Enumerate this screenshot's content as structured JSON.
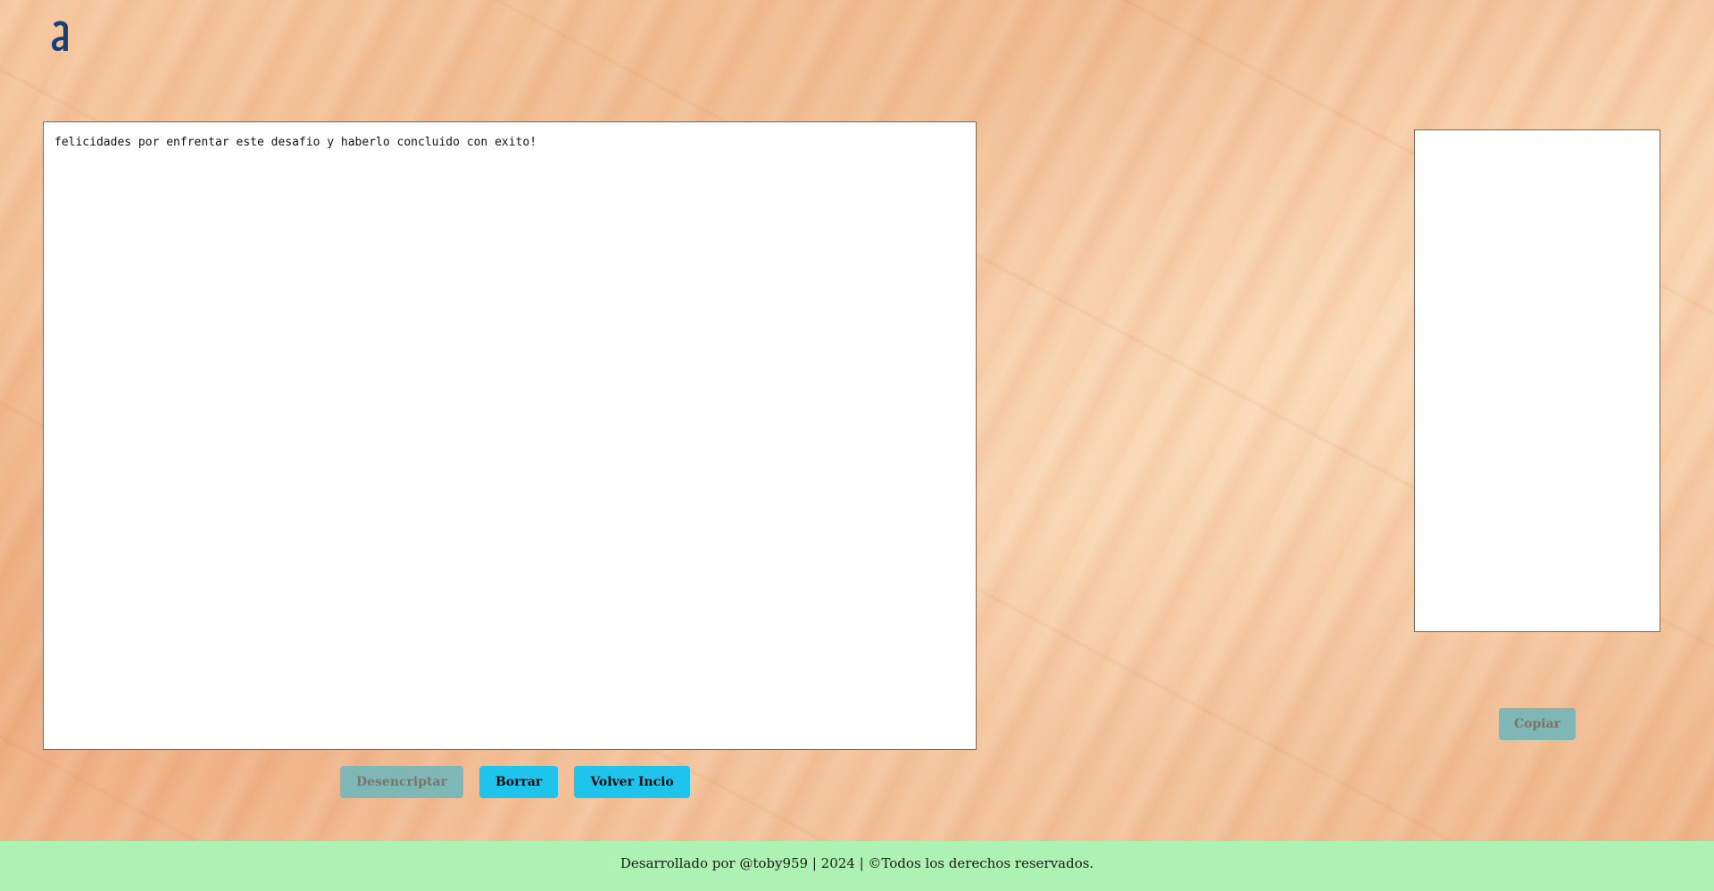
{
  "logo": {
    "icon": "letter-a-logo-icon",
    "color": "#153f77"
  },
  "input": {
    "value": "felicidades por enfrentar este desafio y haberlo concluido con exito!"
  },
  "buttons": {
    "decrypt_label": "Desencriptar",
    "clear_label": "Borrar",
    "home_label": "Volver Incio",
    "copy_label": "Copiar"
  },
  "output": {
    "value": ""
  },
  "footer": {
    "text": "Desarrollado por @toby959 | 2024 | ©Todos los derechos reservados."
  },
  "colors": {
    "accent": "#1fc4ec",
    "disabled_button": "#7fb7b7",
    "footer_bg": "#adf2b2"
  }
}
